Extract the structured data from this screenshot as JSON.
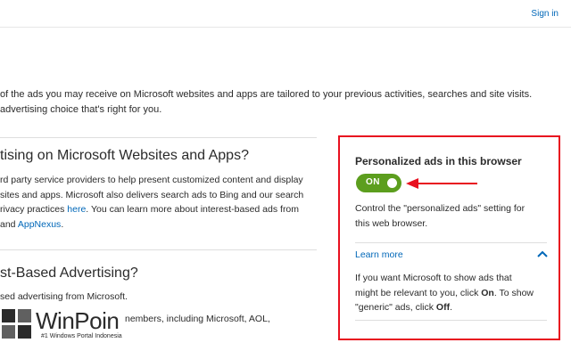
{
  "header": {
    "signin_label": "Sign in"
  },
  "intro": {
    "line1": "of the ads you may receive on Microsoft websites and apps are tailored to your previous activities, searches and site visits.",
    "line2": "advertising choice that's right for you."
  },
  "section1": {
    "title": "tising on Microsoft Websites and Apps?",
    "line1": "rd party service providers to help present customized content and display",
    "line2": "sites and apps. Microsoft also delivers search ads to Bing and our search",
    "line3_pre": "rivacy practices ",
    "line3_link": "here",
    "line3_post": ". You can learn more about interest-based ads from",
    "line4_pre": "and ",
    "line4_link": "AppNexus",
    "line4_post": "."
  },
  "section2": {
    "title": "st-Based Advertising?",
    "line1": "sed advertising from Microsoft.",
    "line2": "nembers, including Microsoft, AOL,"
  },
  "watermark": {
    "name": "WinPoin",
    "tagline": "#1 Windows Portal Indonesia"
  },
  "panel": {
    "title": "Personalized ads in this browser",
    "toggle_label": "ON",
    "toggle_state": "on",
    "desc1": "Control the \"personalized ads\" setting for",
    "desc2": "this web browser.",
    "learn_more": "Learn more",
    "detail1": "If you want Microsoft to show ads that",
    "detail2_pre": "might be relevant to you, click ",
    "detail2_bold": "On",
    "detail2_post": ". To show",
    "detail3_pre": "\"generic\" ads, click ",
    "detail3_bold": "Off",
    "detail3_post": "."
  },
  "colors": {
    "accent_link": "#0067b8",
    "toggle_on": "#5c9e1e",
    "highlight_border": "#e8101f"
  },
  "icons": [
    "chevron-up-icon",
    "arrow-left-icon",
    "winpoin-logo-icon"
  ]
}
